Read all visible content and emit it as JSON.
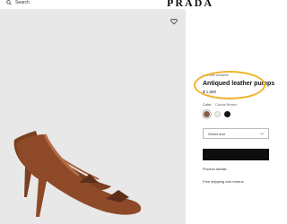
{
  "header": {
    "search_label": "Search",
    "brand": "PRADA"
  },
  "product": {
    "eyebrow": "Last item available",
    "title": "Antiqued leather pumps",
    "price": "$ 1,590",
    "highlight_color": "#f0b429"
  },
  "color_selector": {
    "label": "Color",
    "selected": "Cocoa Brown",
    "swatches": [
      {
        "name": "Cocoa Brown",
        "hex": "#8a5a44",
        "selected": true
      },
      {
        "name": "Ivory",
        "hex": "#f0ece4",
        "selected": false
      },
      {
        "name": "Black",
        "hex": "#111111",
        "selected": false
      }
    ]
  },
  "size_selector": {
    "label": "Select size"
  },
  "actions": {
    "add_to_bag": ""
  },
  "links": {
    "product_details": "Product details",
    "shipping": "Free shipping and returns"
  },
  "icons": {
    "search": "search-icon",
    "wishlist": "heart-icon",
    "dropdown": "chevron-down-icon"
  }
}
